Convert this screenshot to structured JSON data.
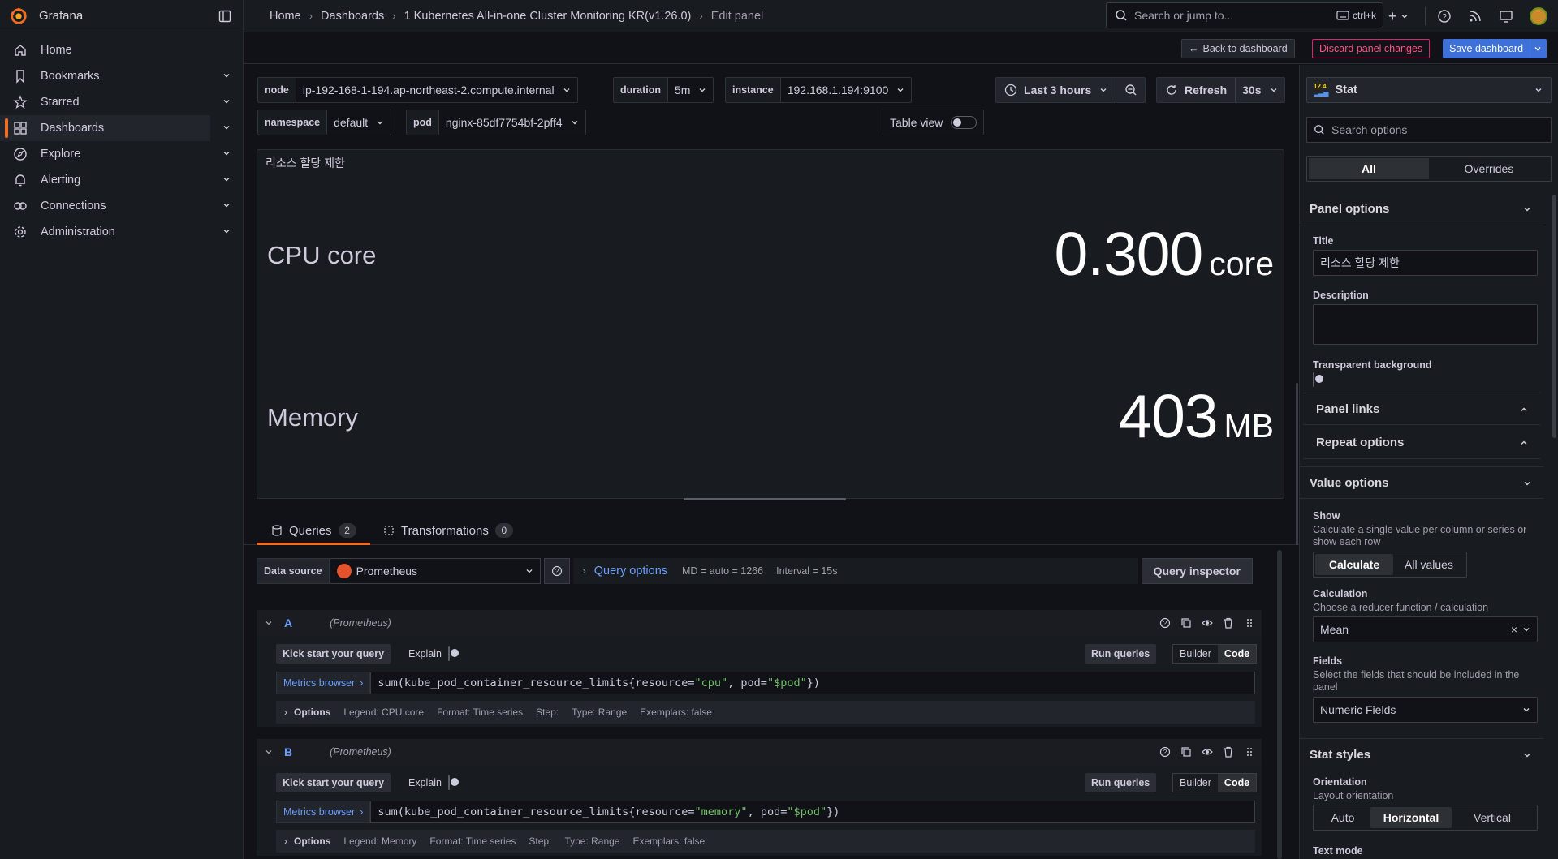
{
  "app": {
    "name": "Grafana",
    "brand_color": "#f26d21",
    "accent": "#3d71d9"
  },
  "breadcrumbs": [
    "Home",
    "Dashboards",
    "1 Kubernetes All-in-one Cluster Monitoring KR(v1.26.0)",
    "Edit panel"
  ],
  "search": {
    "placeholder": "Search or jump to...",
    "shortcut": "ctrl+k"
  },
  "sidebar": {
    "items": [
      {
        "label": "Home",
        "icon": "home-icon"
      },
      {
        "label": "Bookmarks",
        "icon": "bookmark-icon"
      },
      {
        "label": "Starred",
        "icon": "star-icon"
      },
      {
        "label": "Dashboards",
        "icon": "dashboards-icon",
        "active": true
      },
      {
        "label": "Explore",
        "icon": "compass-icon"
      },
      {
        "label": "Alerting",
        "icon": "bell-icon"
      },
      {
        "label": "Connections",
        "icon": "connections-icon"
      },
      {
        "label": "Administration",
        "icon": "gear-icon"
      }
    ]
  },
  "actions": {
    "back": "Back to dashboard",
    "discard": "Discard panel changes",
    "save": "Save dashboard"
  },
  "variables": {
    "node": {
      "label": "node",
      "value": "ip-192-168-1-194.ap-northeast-2.compute.internal"
    },
    "duration": {
      "label": "duration",
      "value": "5m"
    },
    "instance": {
      "label": "instance",
      "value": "192.168.1.194:9100"
    },
    "namespace": {
      "label": "namespace",
      "value": "default"
    },
    "pod": {
      "label": "pod",
      "value": "nginx-85df7754bf-2pff4"
    }
  },
  "time": {
    "range": "Last 3 hours",
    "refresh": "Refresh",
    "interval": "30s",
    "table_view": "Table view"
  },
  "panel": {
    "title": "리소스 할당 제한",
    "stats": [
      {
        "name": "CPU core",
        "value": "0.300",
        "unit": "core"
      },
      {
        "name": "Memory",
        "value": "403",
        "unit": "MB"
      }
    ]
  },
  "tabs": {
    "queries": "Queries",
    "queries_count": "2",
    "transformations": "Transformations",
    "transformations_count": "0"
  },
  "datasource": {
    "label": "Data source",
    "name": "Prometheus",
    "query_options": "Query options",
    "md": "MD = auto = 1266",
    "interval": "Interval = 15s",
    "inspector": "Query inspector"
  },
  "queries": [
    {
      "ref": "A",
      "ds": "(Prometheus)",
      "kick": "Kick start your query",
      "explain": "Explain",
      "run": "Run queries",
      "builder": "Builder",
      "code": "Code",
      "metrics": "Metrics browser",
      "expr_pre": "sum(kube_pod_container_resource_limits{resource=",
      "expr_res": "\"cpu\"",
      "expr_mid": ", pod=",
      "expr_pod": "\"$pod\"",
      "expr_post": "})",
      "options": "Options",
      "legend": "Legend: CPU core",
      "format": "Format: Time series",
      "step": "Step:",
      "type": "Type: Range",
      "exemplars": "Exemplars: false"
    },
    {
      "ref": "B",
      "ds": "(Prometheus)",
      "kick": "Kick start your query",
      "explain": "Explain",
      "run": "Run queries",
      "builder": "Builder",
      "code": "Code",
      "metrics": "Metrics browser",
      "expr_pre": "sum(kube_pod_container_resource_limits{resource=",
      "expr_res": "\"memory\"",
      "expr_mid": ", pod=",
      "expr_pod": "\"$pod\"",
      "expr_post": "})",
      "options": "Options",
      "legend": "Legend: Memory",
      "format": "Format: Time series",
      "step": "Step:",
      "type": "Type: Range",
      "exemplars": "Exemplars: false"
    }
  ],
  "options_pane": {
    "viz": "Stat",
    "search_placeholder": "Search options",
    "tab_all": "All",
    "tab_overrides": "Overrides",
    "panel_options": "Panel options",
    "title_label": "Title",
    "title_value": "리소스 할당 제한",
    "description_label": "Description",
    "transparent_label": "Transparent background",
    "panel_links": "Panel links",
    "repeat_options": "Repeat options",
    "value_options": "Value options",
    "show_label": "Show",
    "show_desc": "Calculate a single value per column or series or show each row",
    "show_calculate": "Calculate",
    "show_all": "All values",
    "calc_label": "Calculation",
    "calc_desc": "Choose a reducer function / calculation",
    "calc_value": "Mean",
    "fields_label": "Fields",
    "fields_desc": "Select the fields that should be included in the panel",
    "fields_value": "Numeric Fields",
    "stat_styles": "Stat styles",
    "orientation_label": "Orientation",
    "orientation_desc": "Layout orientation",
    "orient_auto": "Auto",
    "orient_horizontal": "Horizontal",
    "orient_vertical": "Vertical",
    "text_mode": "Text mode"
  }
}
